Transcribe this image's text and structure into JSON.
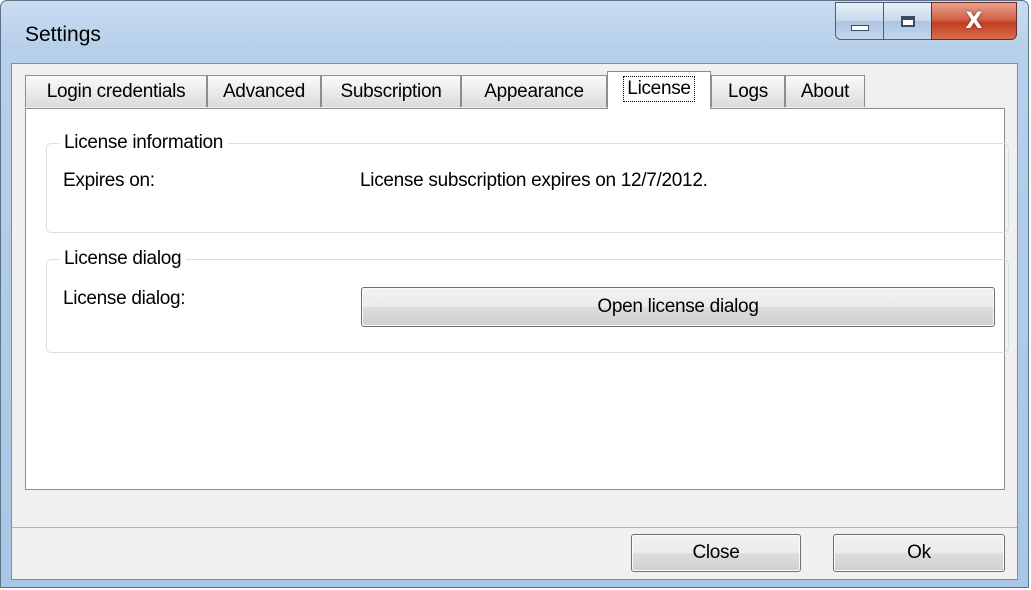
{
  "window": {
    "title": "Settings",
    "caption_buttons": {
      "minimize": "minimize-icon",
      "maximize": "maximize-icon",
      "close": "close-icon",
      "close_glyph": "X"
    }
  },
  "tabs": [
    {
      "label": "Login credentials"
    },
    {
      "label": "Advanced"
    },
    {
      "label": "Subscription"
    },
    {
      "label": "Appearance"
    },
    {
      "label": "License",
      "active": true
    },
    {
      "label": "Logs"
    },
    {
      "label": "About"
    }
  ],
  "license_info": {
    "legend": "License information",
    "expires_label": "Expires on:",
    "expires_value": "License subscription expires on 12/7/2012."
  },
  "license_dialog": {
    "legend": "License dialog",
    "label": "License dialog:",
    "button": "Open license dialog"
  },
  "footer": {
    "close_label": "Close",
    "ok_label": "Ok"
  },
  "colors": {
    "frame": "#b7d0ea",
    "close_button": "#c13d20",
    "client": "#f0f0f0"
  }
}
